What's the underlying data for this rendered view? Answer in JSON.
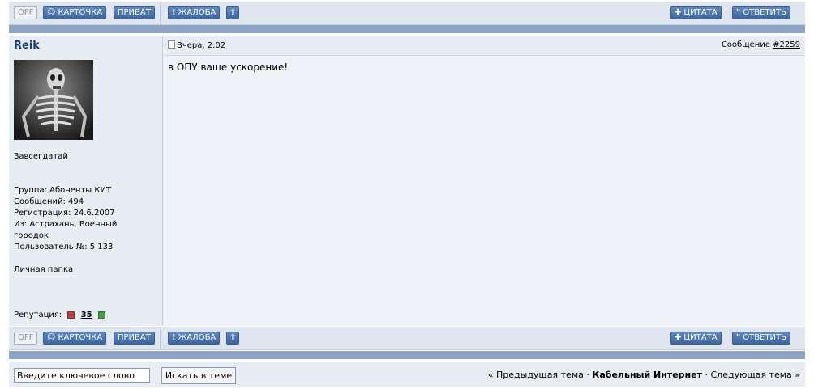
{
  "top_bar": {
    "off_label": "OFF",
    "card_label": "КАРТОЧКА",
    "private_label": "ПРИВАТ",
    "complaint_label": "ЖАЛОБА",
    "quote_label": "ЦИТАТА",
    "reply_label": "ОТВЕТИТЬ"
  },
  "post": {
    "username": "Reik",
    "date": "Вчера, 2:02",
    "message_prefix": "Сообщение",
    "message_number": "#2259",
    "body": "в ОПУ ваше ускорение!",
    "rank": "Завсегдатай",
    "group": "Группа: Абоненты КИТ",
    "messages": "Сообщений: 494",
    "registration": "Регистрация: 24.6.2007",
    "from_line1": "Из: Астрахань, Военный",
    "from_line2": "городок",
    "user_number": "Пользователь №: 5 133",
    "personal_folder": "Личная папка",
    "reputation_label": "Репутация:",
    "reputation_value": "35"
  },
  "bottom_bar": {
    "off_label": "OFF",
    "card_label": "КАРТОЧКА",
    "private_label": "ПРИВАТ",
    "complaint_label": "ЖАЛОБА",
    "quote_label": "ЦИТАТА",
    "reply_label": "ОТВЕТИТЬ"
  },
  "footer": {
    "search_placeholder": "Введите ключевое слово",
    "search_button": "Искать в теме",
    "prev_topic": "« Предыдущая тема",
    "dot1": " · ",
    "forum_name": "Кабельный Интернет",
    "dot2": " · ",
    "next_topic": "Следующая тема »"
  },
  "colors": {
    "button_blue": "#4a72ab",
    "separator": "#8ea4c4",
    "panel": "#e8edf3",
    "username": "#1a3a7a"
  }
}
